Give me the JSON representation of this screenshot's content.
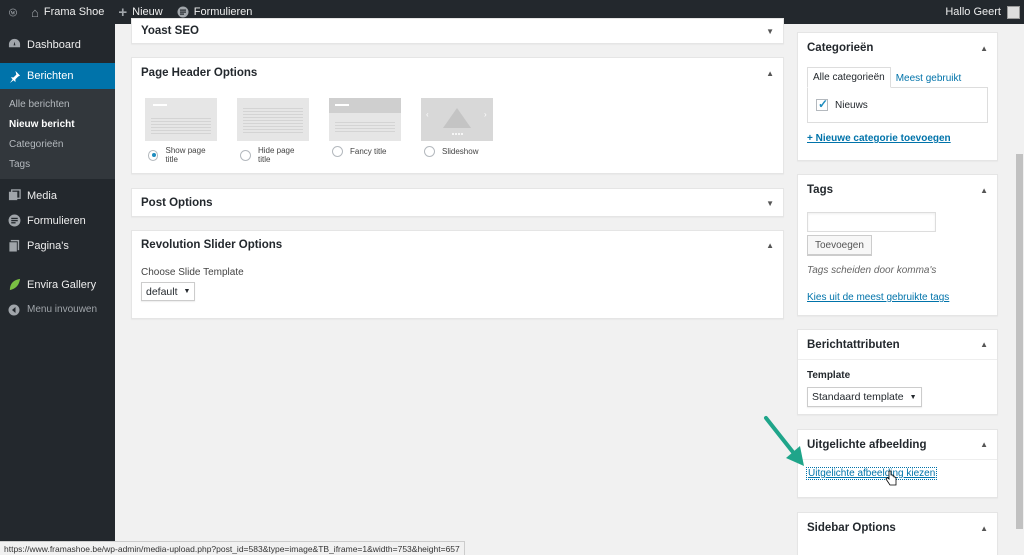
{
  "adminbar": {
    "site_name": "Frama Shoe",
    "new_label": "Nieuw",
    "forms_label": "Formulieren",
    "greeting": "Hallo Geert"
  },
  "sidebar": {
    "items": [
      {
        "label": "Dashboard",
        "icon": "dashboard-icon"
      },
      {
        "label": "Berichten",
        "icon": "pin-icon",
        "active": true
      },
      {
        "label": "Media",
        "icon": "media-icon"
      },
      {
        "label": "Formulieren",
        "icon": "forms-icon"
      },
      {
        "label": "Pagina's",
        "icon": "pages-icon"
      },
      {
        "label": "Envira Gallery",
        "icon": "leaf-icon"
      },
      {
        "label": "Menu invouwen",
        "icon": "collapse-icon"
      }
    ],
    "submenu": [
      "Alle berichten",
      "Nieuw bericht",
      "Categorieën",
      "Tags"
    ]
  },
  "main": {
    "yoast": {
      "title": "Yoast SEO"
    },
    "page_header": {
      "title": "Page Header Options",
      "options": [
        {
          "label": "Show page title",
          "checked": true
        },
        {
          "label": "Hide page title",
          "checked": false
        },
        {
          "label": "Fancy title",
          "checked": false
        },
        {
          "label": "Slideshow",
          "checked": false
        }
      ]
    },
    "post_options": {
      "title": "Post Options"
    },
    "revolution": {
      "title": "Revolution Slider Options",
      "field_label": "Choose Slide Template",
      "select_value": "default"
    }
  },
  "right": {
    "categories": {
      "title": "Categorieën",
      "tab_all": "Alle categorieën",
      "tab_most": "Meest gebruikt",
      "items": [
        {
          "label": "Nieuws",
          "checked": true
        }
      ],
      "add_link": "+ Nieuwe categorie toevoegen"
    },
    "tags": {
      "title": "Tags",
      "input_value": "",
      "add_button": "Toevoegen",
      "help": "Tags scheiden door komma's",
      "choose_link": "Kies uit de meest gebruikte tags"
    },
    "attributes": {
      "title": "Berichtattributen",
      "template_label": "Template",
      "template_value": "Standaard template"
    },
    "featured": {
      "title": "Uitgelichte afbeelding",
      "link": "Uitgelichte afbeelding kiezen"
    },
    "sidebar_options": {
      "title": "Sidebar Options"
    }
  },
  "statusbar": {
    "url": "https://www.framashoe.be/wp-admin/media-upload.php?post_id=583&type=image&TB_iframe=1&width=753&height=657"
  },
  "colors": {
    "adminbar": "#23282d",
    "accent": "#0073aa",
    "annotation_arrow": "#1fa58a"
  }
}
